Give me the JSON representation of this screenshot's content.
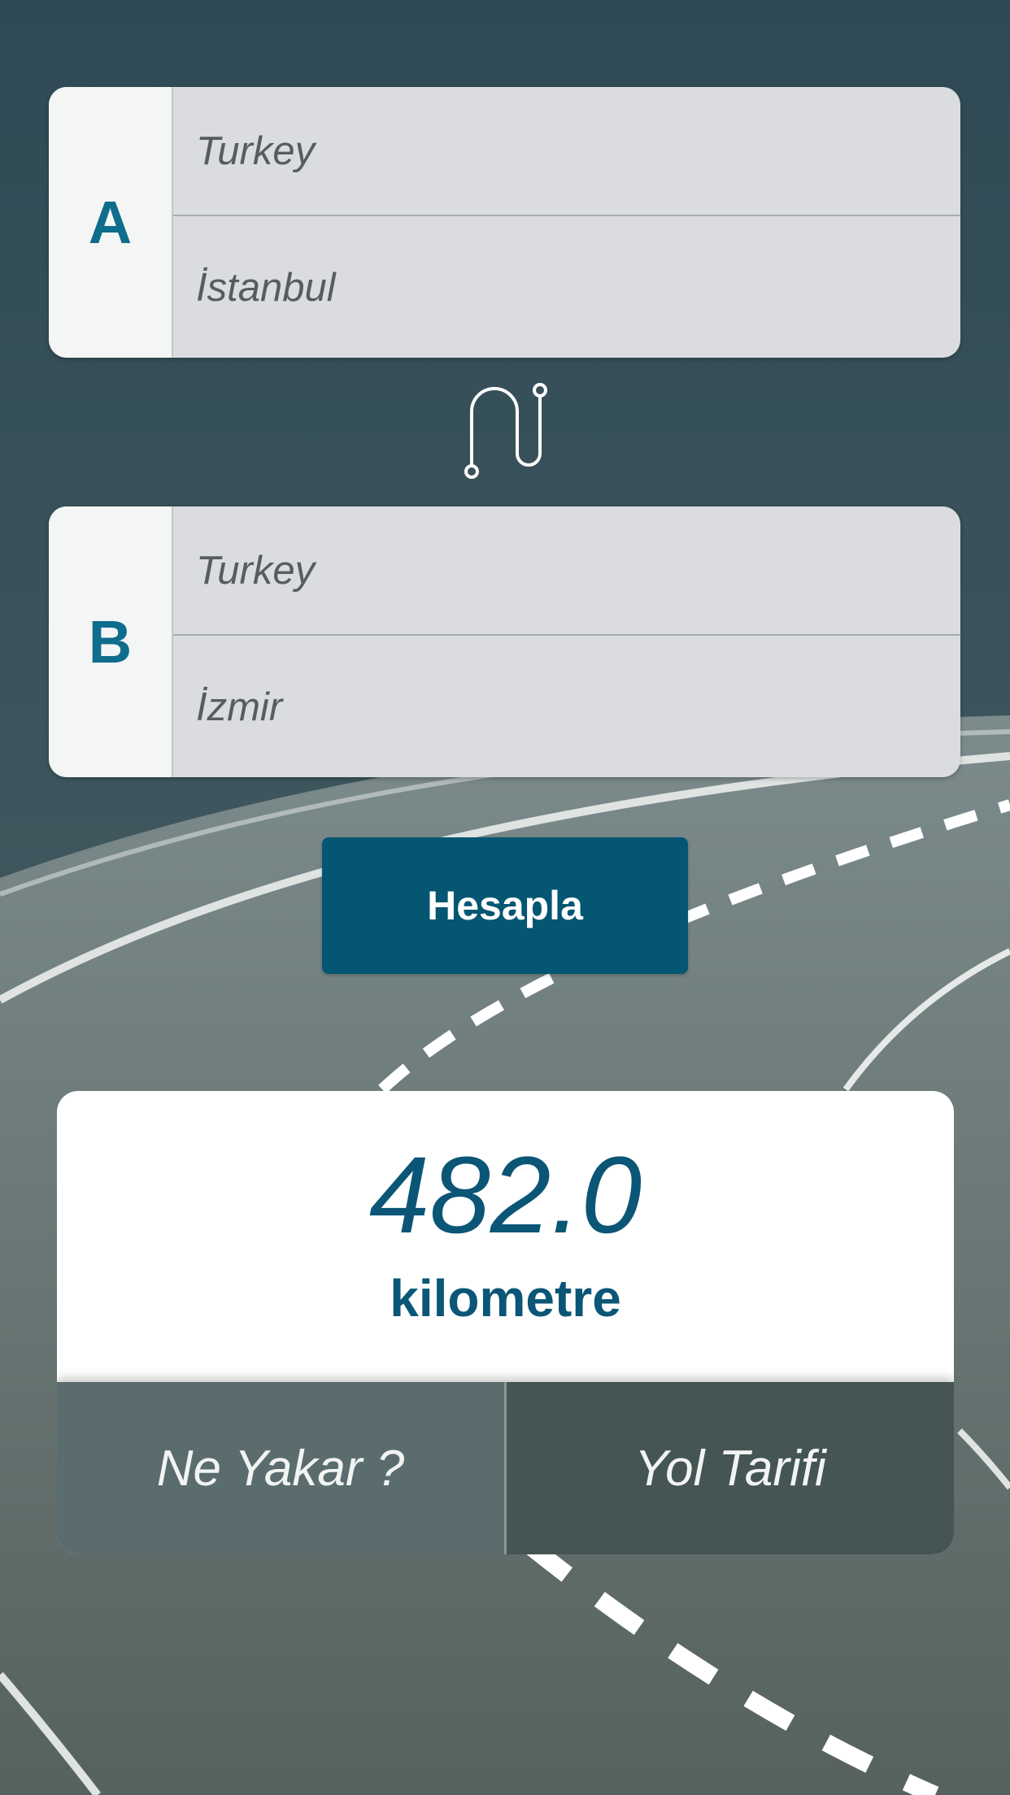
{
  "origin": {
    "letter": "A",
    "country_value": "Turkey",
    "city_value": "İstanbul"
  },
  "destination": {
    "letter": "B",
    "country_value": "Turkey",
    "city_value": "İzmir"
  },
  "route_icon": "route-path-icon",
  "calculate_button": {
    "label": "Hesapla"
  },
  "result": {
    "distance": "482.0",
    "unit": "kilometre"
  },
  "actions": {
    "fuel_label": "Ne Yakar ?",
    "directions_label": "Yol Tarifi"
  },
  "colors": {
    "accent": "#045672",
    "letter": "#0e6c8d",
    "result_text": "#0b5676",
    "left_button": "#5a6c6e",
    "right_button": "#445553"
  }
}
